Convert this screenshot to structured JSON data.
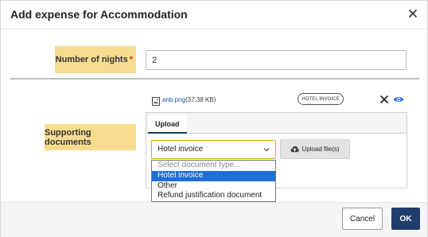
{
  "dialog": {
    "title": "Add expense for Accommodation"
  },
  "nights": {
    "label": "Number of nights",
    "required_mark": "*",
    "value": "2"
  },
  "attachment": {
    "file_name": "anb.png",
    "file_size": "(37.38 KB)",
    "type_badge": "HOTEL INVOICE"
  },
  "documents": {
    "label": "Supporting documents",
    "tab_label": "Upload",
    "selected_value": "Hotel invoice",
    "upload_button_label": "Upload file(s)",
    "options": [
      "Select document type...",
      "Hotel invoice",
      "Other",
      "Refund justification document"
    ]
  },
  "footer": {
    "cancel_label": "Cancel",
    "ok_label": "OK"
  },
  "colors": {
    "label_highlight": "#f7dc90",
    "primary": "#1f3e6e",
    "selected_option": "#1e6fd9",
    "select_focus_border": "#e0a800",
    "required_asterisk": "#ee2222"
  },
  "icons": [
    "close-icon",
    "image-file-icon",
    "remove-icon",
    "eye-icon",
    "chevron-down-icon",
    "cloud-upload-icon"
  ]
}
